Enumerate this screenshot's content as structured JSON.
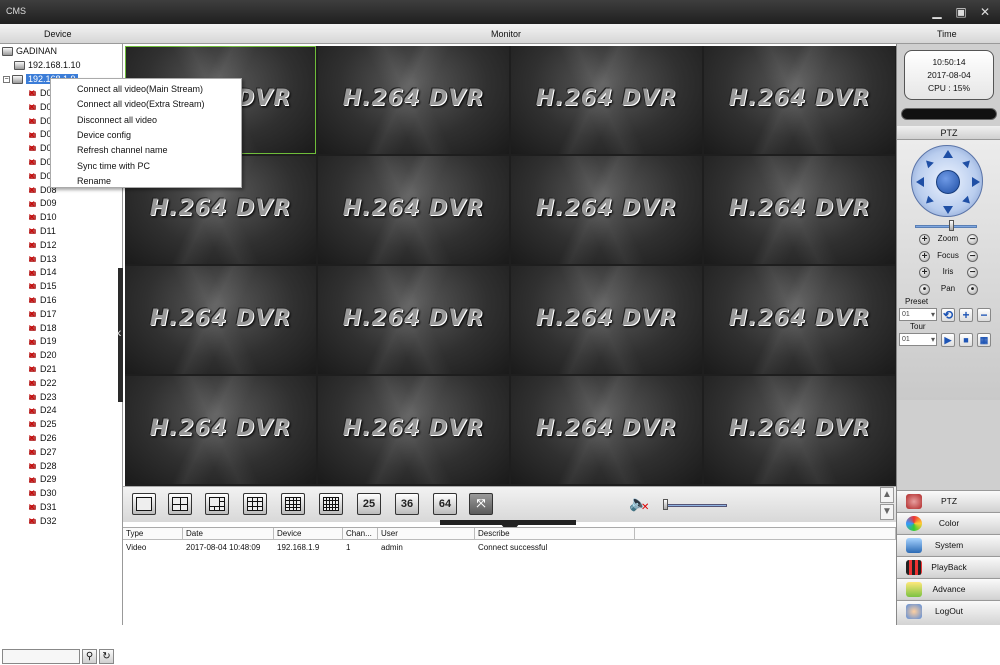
{
  "window": {
    "title": "CMS",
    "minimize": "▁",
    "restore": "▣",
    "close": "✕"
  },
  "headers": {
    "device": "Device",
    "monitor": "Monitor",
    "time": "Time"
  },
  "tree": {
    "root": "GADINAN",
    "device1": "192.168.1.10",
    "device2": "192.168.1.9",
    "channels": [
      "D01",
      "D02",
      "D03",
      "D04",
      "D05",
      "D06",
      "D07",
      "D08",
      "D09",
      "D10",
      "D11",
      "D12",
      "D13",
      "D14",
      "D15",
      "D16",
      "D17",
      "D18",
      "D19",
      "D20",
      "D21",
      "D22",
      "D23",
      "D24",
      "D25",
      "D26",
      "D27",
      "D28",
      "D29",
      "D30",
      "D31",
      "D32"
    ]
  },
  "context_menu": {
    "items": [
      "Connect all video(Main Stream)",
      "Connect all video(Extra Stream)",
      "Disconnect all video",
      "Device config",
      "Refresh channel name",
      "Sync time with PC",
      "Rename"
    ]
  },
  "video": {
    "cell_text": "H.264 DVR"
  },
  "toolbar": {
    "layout_25": "25",
    "layout_36": "36",
    "layout_64": "64"
  },
  "log": {
    "headers": [
      "Type",
      "Date",
      "Device",
      "Chan...",
      "User",
      "Describe"
    ],
    "rows": [
      [
        "Video",
        "2017-08-04 10:48:09",
        "192.168.1.9",
        "1",
        "admin",
        "Connect successful"
      ]
    ]
  },
  "clock": {
    "time": "10:50:14",
    "date": "2017-08-04",
    "cpu": "CPU : 15%"
  },
  "ptz": {
    "header": "PTZ",
    "zoom": "Zoom",
    "focus": "Focus",
    "iris": "Iris",
    "pan": "Pan",
    "preset_label": "Preset",
    "preset_value": "01",
    "tour_label": "Tour",
    "tour_value": "01"
  },
  "menu": {
    "ptz": "PTZ",
    "color": "Color",
    "system": "System",
    "playback": "PlayBack",
    "advance": "Advance",
    "logout": "LogOut"
  },
  "colors": {
    "accent": "#3b7dd8",
    "selection_border": "#6fbd3a",
    "ptz_blue": "#1f4fa5"
  }
}
